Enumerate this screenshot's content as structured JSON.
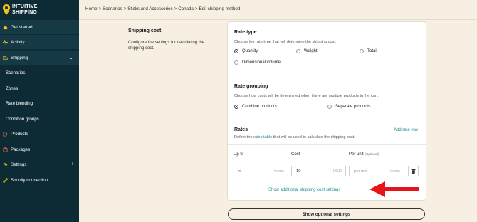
{
  "brand": {
    "line1": "INTUITIVE",
    "line2": "SHIPPING"
  },
  "sidebar": {
    "items": [
      {
        "label": "Get started",
        "icon": "home-icon"
      },
      {
        "label": "Activity",
        "icon": "activity-icon"
      },
      {
        "label": "Shipping",
        "icon": "truck-icon",
        "expanded": true
      },
      {
        "label": "Scenarios"
      },
      {
        "label": "Zones"
      },
      {
        "label": "Rate blending"
      },
      {
        "label": "Condition groups"
      },
      {
        "label": "Products",
        "icon": "tag-icon"
      },
      {
        "label": "Packages",
        "icon": "package-icon"
      },
      {
        "label": "Settings",
        "icon": "gear-icon"
      },
      {
        "label": "Shopify connection",
        "icon": "link-icon"
      }
    ]
  },
  "breadcrumb": [
    "Home",
    "Scenarios",
    "Sticks and Accessories",
    "Canada",
    "Edit shipping method"
  ],
  "left": {
    "title": "Shipping cost",
    "description": "Configure the settings for calculating the shipping cost."
  },
  "rate_type": {
    "title": "Rate type",
    "description": "Choose the rate type that will determine the shipping cost.",
    "options": [
      "Quantity",
      "Weight",
      "Total",
      "Dimensional volume"
    ],
    "selected": "Quantity"
  },
  "rate_grouping": {
    "title": "Rate grouping",
    "description": "Choose how costs will be determined when there are multiple products in the cart.",
    "options": [
      "Combine products",
      "Separate products"
    ],
    "selected": "Combine products"
  },
  "rates": {
    "title": "Rates",
    "desc_before": "Define the",
    "desc_link": "rates table",
    "desc_after": "that will be used to calculate the shipping cost.",
    "add_label": "Add rate row",
    "columns": {
      "up_to": "Up to",
      "cost": "Cost",
      "per_unit": "Per unit",
      "optional": "(Optional)"
    },
    "row": {
      "up_to_value": "∞",
      "up_to_suffix": "items",
      "cost_value": "10",
      "cost_suffix": "USD",
      "per_unit_placeholder": "per unit",
      "per_unit_suffix": "items"
    },
    "additional_link": "Show additional shipping cost settings"
  },
  "optional_button": "Show optional settings",
  "colors": {
    "sidebar": "#0d2b34",
    "accent": "#1f8a8f",
    "background": "#f6efe2",
    "arrow": "#e8141c",
    "icon_yellow": "#f2c21b"
  }
}
